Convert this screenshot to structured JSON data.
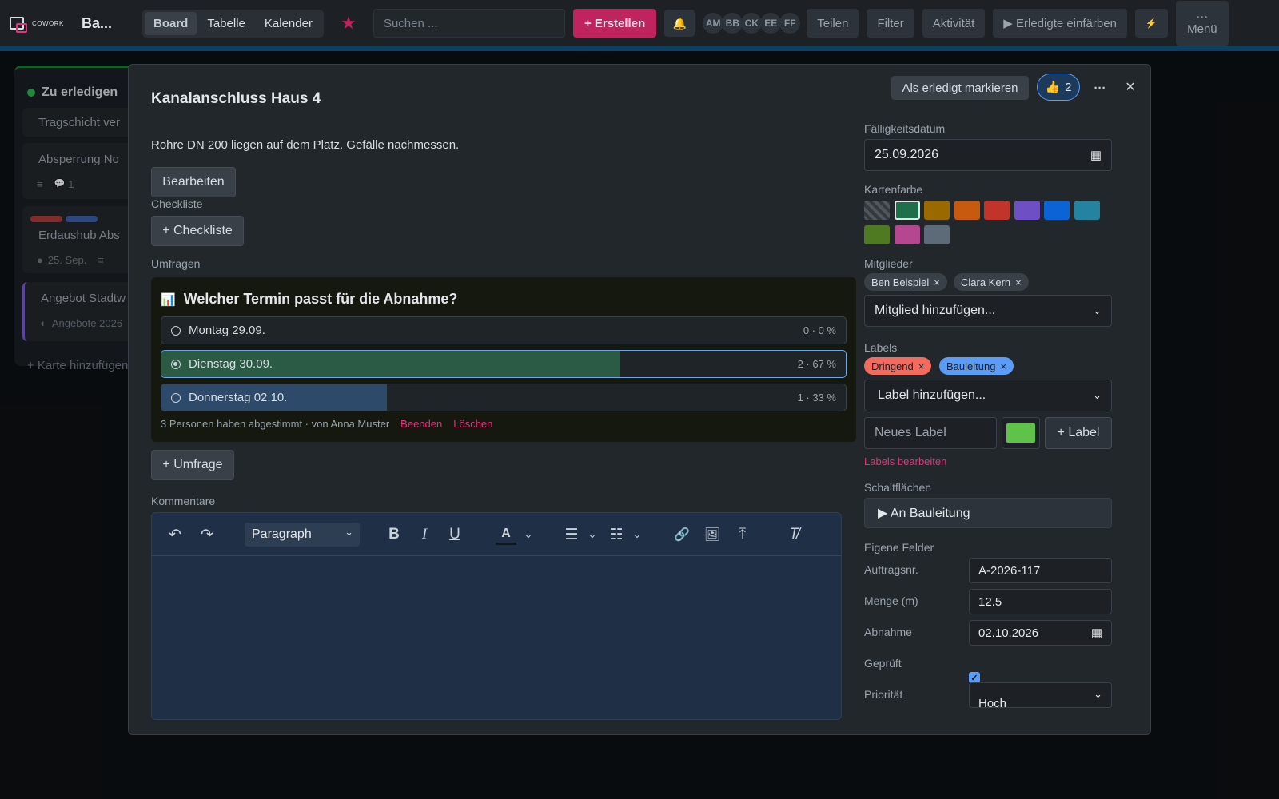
{
  "app": {
    "logo_text": "COWORK",
    "board_title": "Ba..."
  },
  "topbar": {
    "views": [
      "Board",
      "Tabelle",
      "Kalender"
    ],
    "search_placeholder": "Suchen ...",
    "create_label": "+ Erstellen",
    "bell_icon": "🔔",
    "avatars": [
      "AM",
      "BB",
      "CK",
      "EE",
      "FF"
    ],
    "share_label": "Teilen",
    "filter_label": "Filter",
    "activity_label": "Aktivität",
    "color_done_label": "▶ Erledigte einfärben",
    "lightning_icon": "⚡",
    "menu_dots": "···",
    "menu_label": "Menü"
  },
  "list": {
    "title": "Zu erledigen",
    "cards": [
      {
        "title": "Tragschicht ver"
      },
      {
        "title": "Absperrung No",
        "meta_icon": "≡",
        "comment_icon": "💬",
        "comments": "1"
      },
      {
        "title": "Erdaushub Abs",
        "meta_date": "25. Sep.",
        "meta_icon": "≡"
      },
      {
        "title": "Angebot Stadtw",
        "meta": "Angebote 2026"
      }
    ],
    "add_card": "+ Karte hinzufügen"
  },
  "modal": {
    "title": "Kanalanschluss Haus 4",
    "description": "Rohre DN 200 liegen auf dem Platz. Gefälle nachmessen.",
    "edit_button": "Bearbeiten",
    "mark_done_button": "Als erledigt markieren",
    "like_icon": "👍",
    "like_count": "2",
    "more_icon": "···",
    "close_icon": "✕",
    "checklist_label": "Checkliste",
    "checklist_button": "+ Checkliste",
    "polls_label": "Umfragen",
    "poll": {
      "icon": "📊",
      "question": "Welcher Termin passt für die Abnahme?",
      "options": [
        {
          "label": "Montag 29.09.",
          "stat": "0 · 0 %",
          "percent": 0,
          "selected": false
        },
        {
          "label": "Dienstag 30.09.",
          "stat": "2 · 67 %",
          "percent": 67,
          "selected": true
        },
        {
          "label": "Donnerstag 02.10.",
          "stat": "1 · 33 %",
          "percent": 33,
          "selected": false
        }
      ],
      "footer": "3 Personen haben abgestimmt · von Anna Muster",
      "end_link": "Beenden",
      "delete_link": "Löschen"
    },
    "poll_button": "+ Umfrage",
    "comments_label": "Kommentare",
    "editor": {
      "block_format": "Paragraph",
      "undo_icon": "↶",
      "redo_icon": "↷",
      "bold_icon": "B",
      "italic_icon": "I",
      "underline_icon": "U",
      "font_color_icon": "A",
      "bullet_icon": "☰",
      "numbered_icon": "☷",
      "link_icon": "🔗",
      "image_icon": "🖼",
      "upload_icon": "⤒",
      "clear_format_icon": "T̸"
    },
    "side": {
      "due_label": "Fälligkeitsdatum",
      "due_value": "25.09.2026",
      "calendar_icon": "▦",
      "color_label": "Kartenfarbe",
      "colors": [
        "#1f6f4a",
        "#9a6a00",
        "#c75a0e",
        "#c2332b",
        "#6e4fc4",
        "#0b63d6",
        "#2483a1",
        "#4f7a22",
        "#b54690",
        "#5d6b78"
      ],
      "members_label": "Mitglieder",
      "members": [
        "Ben Beispiel",
        "Clara Kern"
      ],
      "add_member": "Mitglied hinzufügen...",
      "labels_label": "Labels",
      "labels": [
        {
          "name": "Dringend",
          "color": "#f26b5e"
        },
        {
          "name": "Bauleitung",
          "color": "#5b9cf6"
        }
      ],
      "add_label": "Label hinzufügen...",
      "new_label_placeholder": "Neues Label",
      "new_label_color": "#5fc34a",
      "add_label_button": "+ Label",
      "edit_labels_link": "Labels bearbeiten",
      "buttons_label": "Schaltflächen",
      "action_button": "▶ An Bauleitung",
      "custom_fields_label": "Eigene Felder",
      "fields": [
        {
          "label": "Auftragsnr.",
          "value": "A-2026-117"
        },
        {
          "label": "Menge (m)",
          "value": "12.5"
        },
        {
          "label": "Abnahme",
          "value": "02.10.2026"
        },
        {
          "label": "Geprüft",
          "value": "✓"
        },
        {
          "label": "Priorität",
          "value": "Hoch"
        }
      ]
    }
  }
}
